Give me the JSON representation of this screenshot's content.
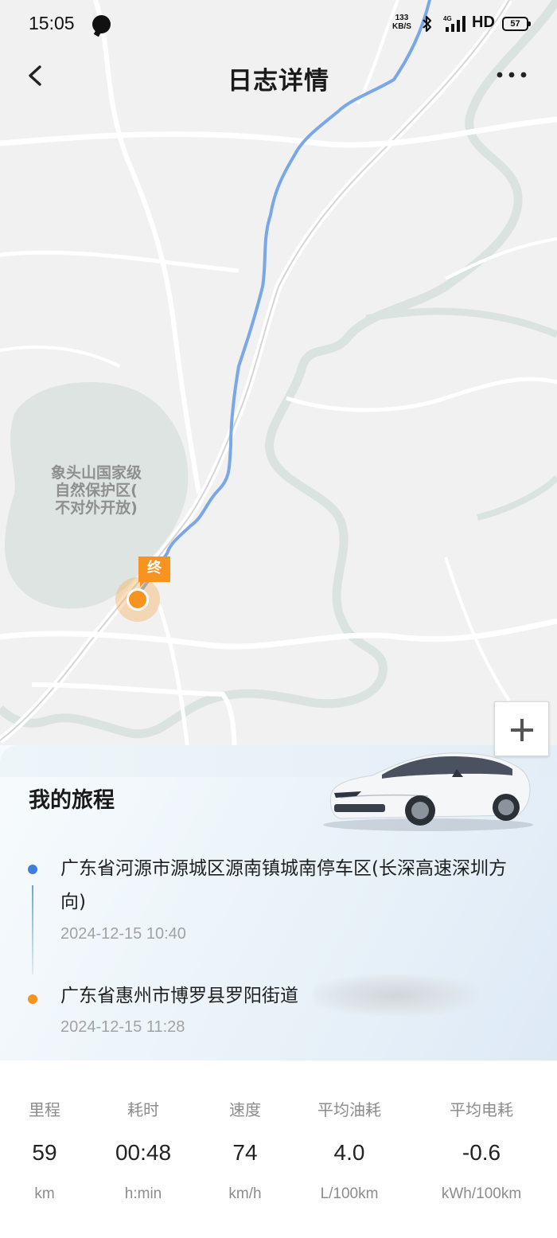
{
  "status_bar": {
    "time": "15:05",
    "net_speed_value": "133",
    "net_speed_unit": "KB/S",
    "network": "HD",
    "battery": "57"
  },
  "header": {
    "title": "日志详情",
    "back_icon": "chevron-left-icon",
    "more_icon": "more-dots-icon"
  },
  "map": {
    "poi_label": "象头山国家级\n自然保护区(\n不对外开放)",
    "end_tag": "终",
    "route_color": "#7aa7e6",
    "end_color": "#f7931e",
    "zoom_in_icon": "plus-icon"
  },
  "trip": {
    "title": "我的旅程",
    "start": {
      "address": "广东省河源市源城区源南镇城南停车区(长深高速深圳方向)",
      "time": "2024-12-15 10:40",
      "color": "#3d7fdb"
    },
    "end": {
      "address": "广东省惠州市博罗县罗阳街道",
      "time": "2024-12-15 11:28",
      "color": "#f7931e"
    }
  },
  "stats": [
    {
      "label": "里程",
      "value": "59",
      "unit": "km"
    },
    {
      "label": "耗时",
      "value": "00:48",
      "unit": "h:min"
    },
    {
      "label": "速度",
      "value": "74",
      "unit": "km/h"
    },
    {
      "label": "平均油耗",
      "value": "4.0",
      "unit": "L/100km"
    },
    {
      "label": "平均电耗",
      "value": "-0.6",
      "unit": "kWh/100km"
    }
  ]
}
